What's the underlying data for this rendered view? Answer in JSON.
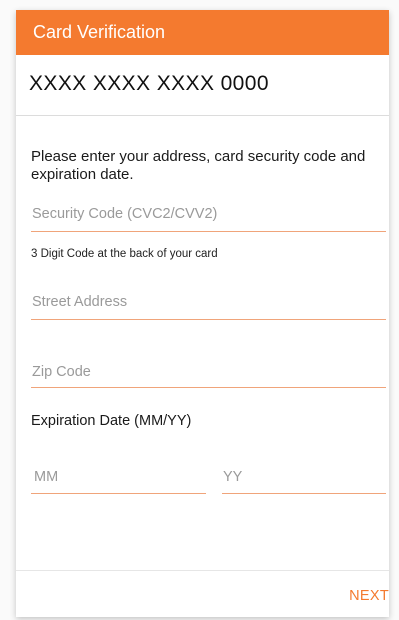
{
  "header": {
    "title": "Card Verification"
  },
  "card": {
    "masked_number": "XXXX XXXX XXXX 0000"
  },
  "form": {
    "instruction": "Please enter your address, card security code and expiration date.",
    "security_code": {
      "placeholder": "Security Code (CVC2/CVV2)",
      "value": ""
    },
    "security_hint": "3 Digit Code at the back of your card",
    "street_address": {
      "placeholder": "Street Address",
      "value": ""
    },
    "zip_code": {
      "placeholder": "Zip Code",
      "value": ""
    },
    "expiration_label": "Expiration Date (MM/YY)",
    "expiration_month": {
      "placeholder": "MM",
      "value": ""
    },
    "expiration_year": {
      "placeholder": "YY",
      "value": ""
    }
  },
  "footer": {
    "next_label": "NEXT"
  },
  "colors": {
    "accent": "#f47a2f",
    "field_underline": "#f0a47a",
    "placeholder_text": "#9a9a9a"
  }
}
